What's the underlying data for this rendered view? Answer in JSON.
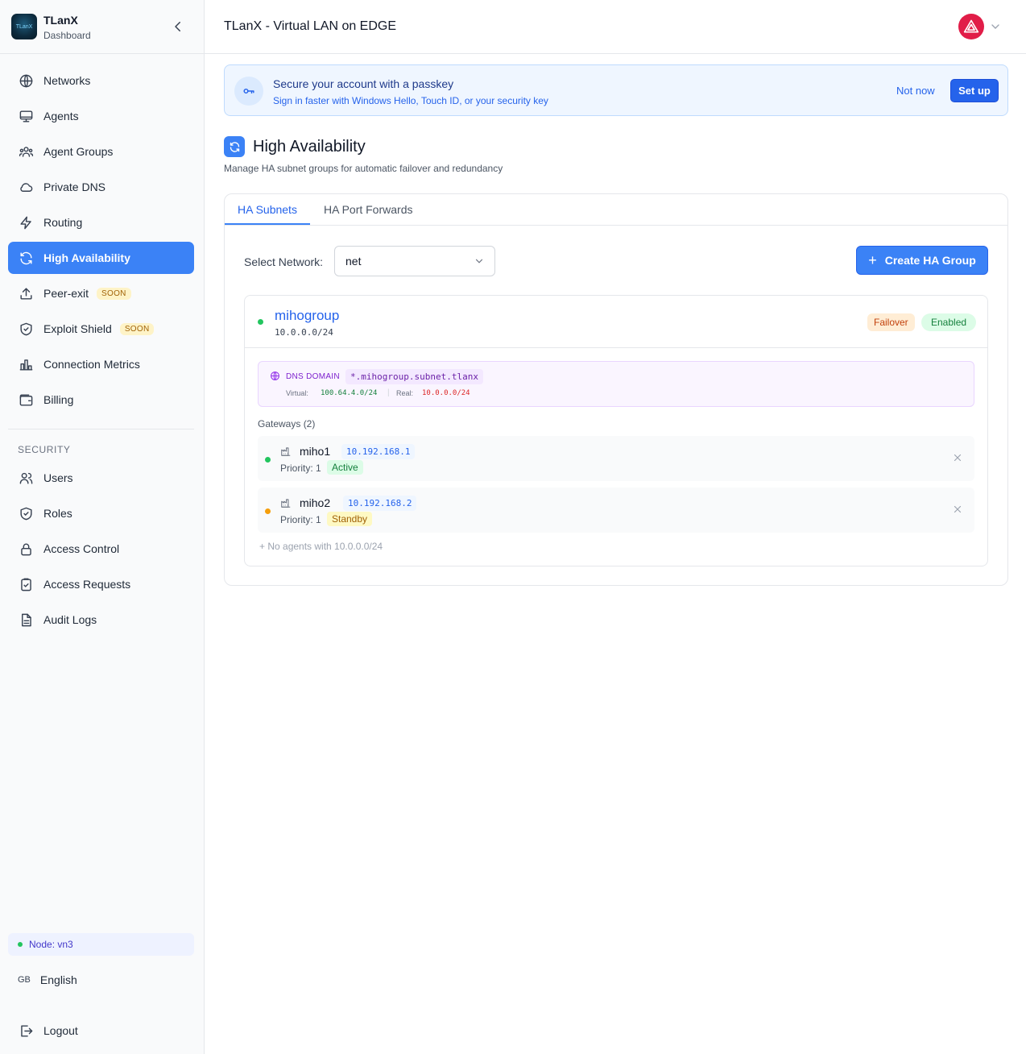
{
  "brand": {
    "title": "TLanX",
    "subtitle": "Dashboard",
    "logo_text": "TLanX"
  },
  "topbar": {
    "title": "TLanX - Virtual LAN on EDGE"
  },
  "sidebar": {
    "items": [
      {
        "label": "Networks",
        "icon": "globe-icon"
      },
      {
        "label": "Agents",
        "icon": "monitor-icon"
      },
      {
        "label": "Agent Groups",
        "icon": "users-group-icon"
      },
      {
        "label": "Private DNS",
        "icon": "cloud-icon"
      },
      {
        "label": "Routing",
        "icon": "bolt-icon"
      },
      {
        "label": "High Availability",
        "icon": "refresh-icon",
        "active": true
      },
      {
        "label": "Peer-exit",
        "icon": "upload-icon",
        "badge": "SOON"
      },
      {
        "label": "Exploit Shield",
        "icon": "shield-check-icon",
        "badge": "SOON"
      },
      {
        "label": "Connection Metrics",
        "icon": "bar-chart-icon"
      },
      {
        "label": "Billing",
        "icon": "wallet-icon"
      }
    ],
    "security_label": "SECURITY",
    "security_items": [
      {
        "label": "Users",
        "icon": "users-icon"
      },
      {
        "label": "Roles",
        "icon": "shield-icon"
      },
      {
        "label": "Access Control",
        "icon": "lock-icon"
      },
      {
        "label": "Access Requests",
        "icon": "clipboard-check-icon"
      },
      {
        "label": "Audit Logs",
        "icon": "file-text-icon"
      }
    ],
    "node": "Node: vn3",
    "language": {
      "flag": "GB",
      "label": "English"
    },
    "logout": "Logout"
  },
  "banner": {
    "title": "Secure your account with a passkey",
    "subtitle": "Sign in faster with Windows Hello, Touch ID, or your security key",
    "not_now": "Not now",
    "setup": "Set up"
  },
  "page": {
    "title": "High Availability",
    "subtitle": "Manage HA subnet groups for automatic failover and redundancy"
  },
  "tabs": [
    "HA Subnets",
    "HA Port Forwards"
  ],
  "select_network": {
    "label": "Select Network:",
    "value": "net"
  },
  "create_button": "Create HA Group",
  "group": {
    "name": "mihogroup",
    "cidr": "10.0.0.0/24",
    "badges": {
      "failover": "Failover",
      "enabled": "Enabled"
    },
    "dns": {
      "label": "DNS DOMAIN",
      "domain": "*.mihogroup.subnet.tlanx",
      "virtual_label": "Virtual:",
      "virtual": "100.64.4.0/24",
      "separator": "|",
      "real_label": "Real:",
      "real": "10.0.0.0/24"
    },
    "gateways_title": "Gateways (2)",
    "gateways": [
      {
        "name": "miho1",
        "ip": "10.192.168.1",
        "priority": "Priority: 1",
        "status": "Active",
        "dot_color": "#22c55e"
      },
      {
        "name": "miho2",
        "ip": "10.192.168.2",
        "priority": "Priority: 1",
        "status": "Standby",
        "dot_color": "#f59e0b"
      }
    ],
    "no_agents": "+  No agents with 10.0.0.0/24"
  },
  "colors": {
    "accent": "#3b82f6",
    "online": "#22c55e",
    "standby": "#f59e0b"
  }
}
